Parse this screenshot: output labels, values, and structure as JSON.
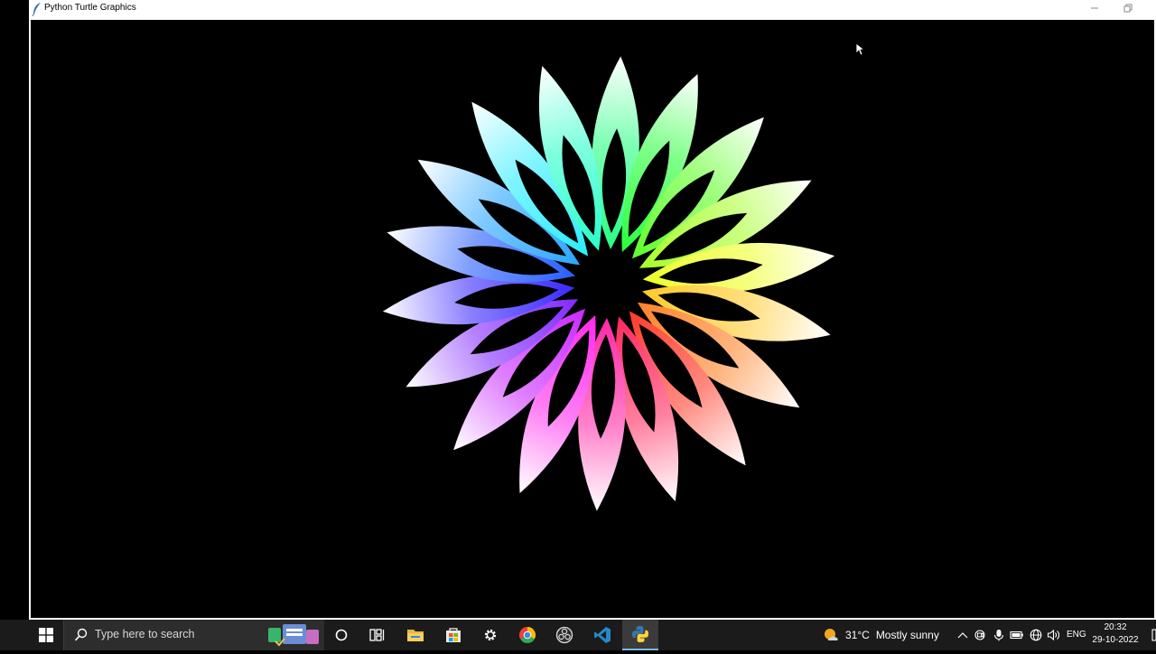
{
  "window": {
    "title": "Python Turtle Graphics",
    "icon": "feather-icon"
  },
  "canvas": {
    "background": "#000000",
    "petal_count": 18,
    "center_color": "#000000"
  },
  "taskbar": {
    "search_placeholder": "Type here to search",
    "pinned_apps": [
      "file-explorer-icon",
      "microsoft-store-icon",
      "settings-icon",
      "chrome-icon",
      "obs-icon",
      "vscode-icon",
      "python-icon"
    ],
    "weather": {
      "temperature": "31°C",
      "condition": "Mostly sunny",
      "icon": "sun-cloud-icon"
    },
    "language": "ENG",
    "time": "20:32",
    "date": "29-10-2022",
    "accent": "#76b9ed"
  }
}
